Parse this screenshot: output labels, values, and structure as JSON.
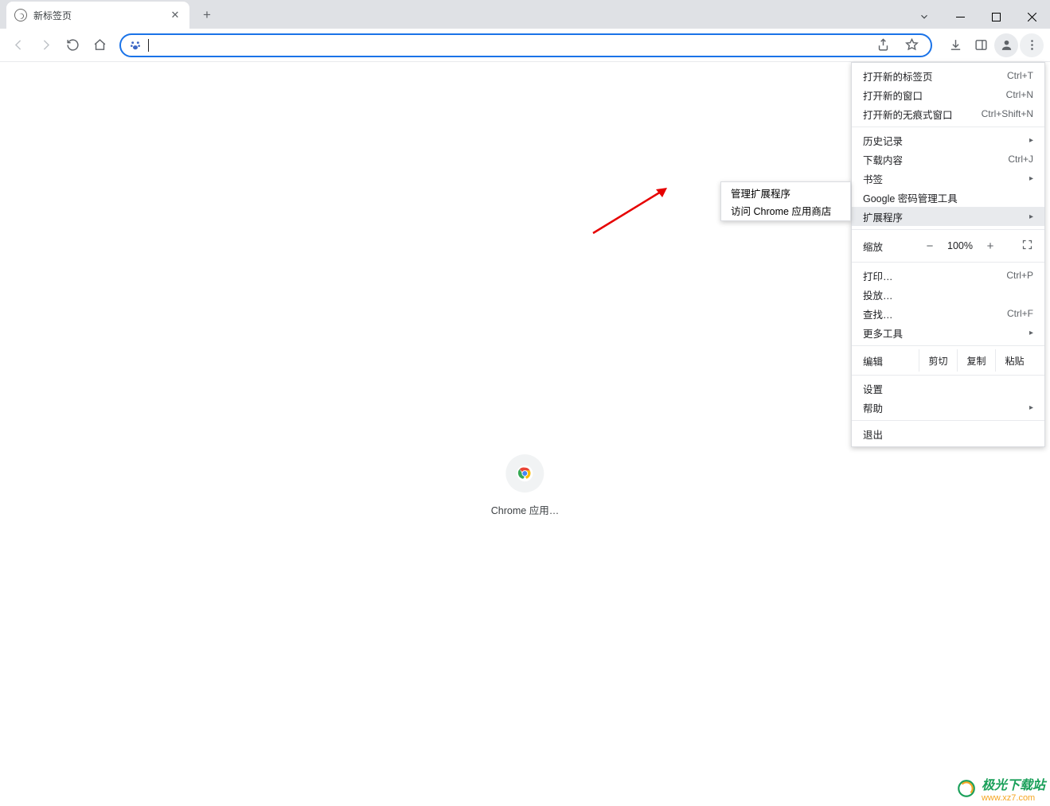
{
  "tab": {
    "title": "新标签页"
  },
  "shortcut": {
    "label": "Chrome 应用…"
  },
  "menu": {
    "new_tab": "打开新的标签页",
    "new_tab_sc": "Ctrl+T",
    "new_window": "打开新的窗口",
    "new_window_sc": "Ctrl+N",
    "incognito": "打开新的无痕式窗口",
    "incognito_sc": "Ctrl+Shift+N",
    "history": "历史记录",
    "downloads": "下载内容",
    "downloads_sc": "Ctrl+J",
    "bookmarks": "书签",
    "passwords": "Google 密码管理工具",
    "extensions": "扩展程序",
    "zoom_label": "缩放",
    "zoom_value": "100%",
    "print": "打印…",
    "print_sc": "Ctrl+P",
    "cast": "投放…",
    "find": "查找…",
    "find_sc": "Ctrl+F",
    "more_tools": "更多工具",
    "edit_label": "编辑",
    "cut": "剪切",
    "copy": "复制",
    "paste": "粘贴",
    "settings": "设置",
    "help": "帮助",
    "exit": "退出"
  },
  "submenu": {
    "manage": "管理扩展程序",
    "store": "访问 Chrome 应用商店"
  },
  "watermark": {
    "line1": "极光下载站",
    "line2": "www.xz7.com"
  }
}
